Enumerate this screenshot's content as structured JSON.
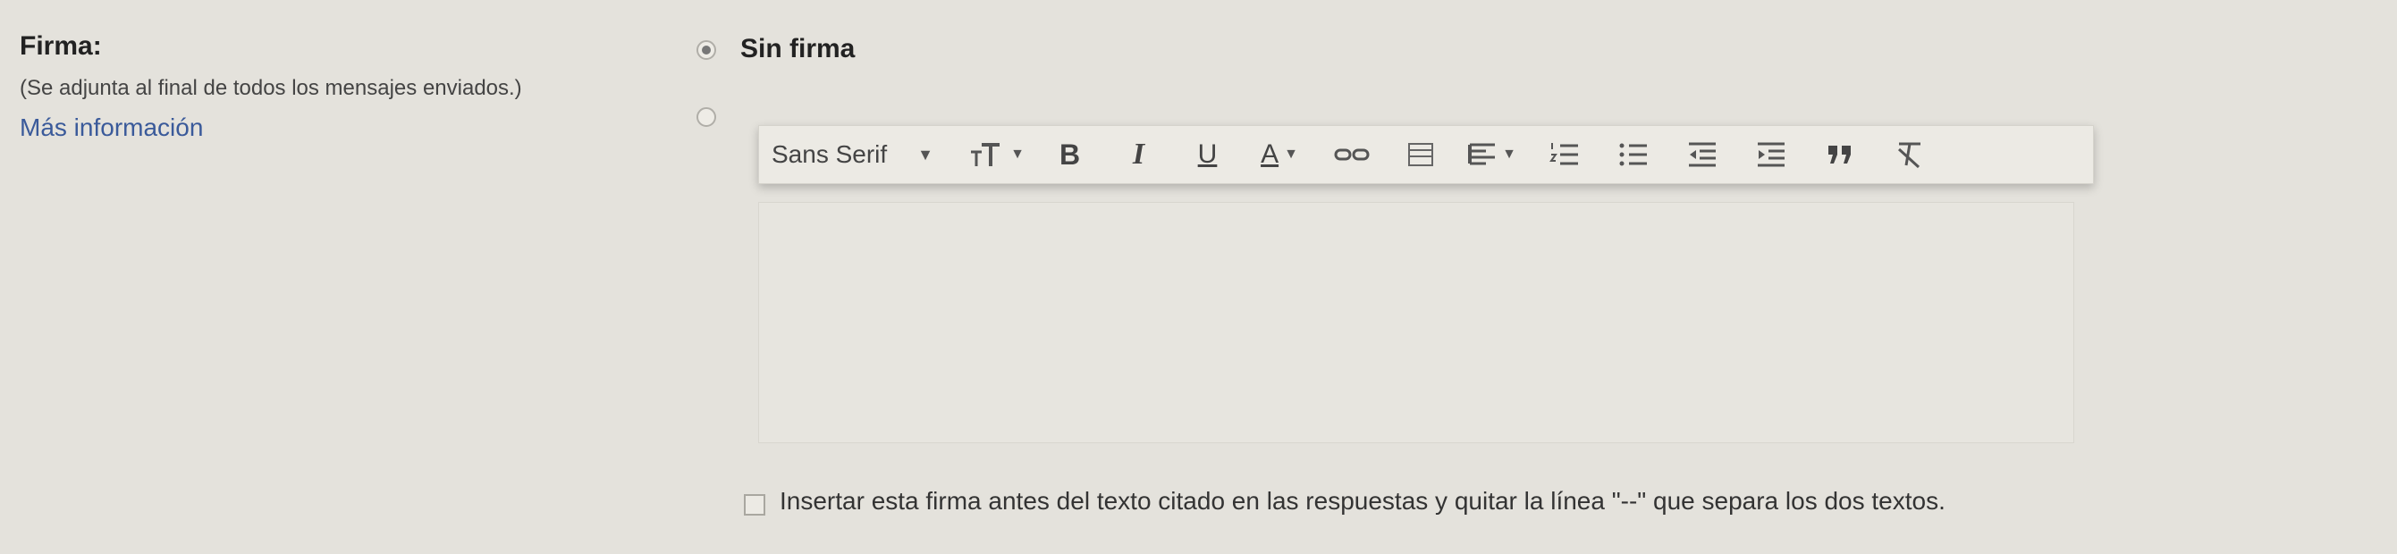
{
  "signature": {
    "title": "Firma:",
    "subtitle": "(Se adjunta al final de todos los mensajes enviados.)",
    "link": "Más información"
  },
  "options": {
    "none_label": "Sin firma",
    "selected": "none"
  },
  "toolbar": {
    "font_family": "Sans Serif",
    "buttons": [
      {
        "name": "text-size",
        "icon": "text-size-icon"
      },
      {
        "name": "bold",
        "label": "B"
      },
      {
        "name": "italic",
        "label": "I"
      },
      {
        "name": "underline",
        "label": "U"
      },
      {
        "name": "text-color",
        "label": "A"
      },
      {
        "name": "link",
        "icon": "link-icon"
      },
      {
        "name": "image",
        "icon": "image-icon"
      },
      {
        "name": "align",
        "icon": "align-left-icon"
      },
      {
        "name": "numbered-list",
        "icon": "numbered-list-icon"
      },
      {
        "name": "bulleted-list",
        "icon": "bulleted-list-icon"
      },
      {
        "name": "indent-less",
        "icon": "indent-less-icon"
      },
      {
        "name": "indent-more",
        "icon": "indent-more-icon"
      },
      {
        "name": "quote",
        "icon": "quote-icon"
      },
      {
        "name": "remove-formatting",
        "icon": "remove-formatting-icon"
      }
    ]
  },
  "editor": {
    "value": ""
  },
  "insert_before_quote": {
    "checked": false,
    "label": "Insertar esta firma antes del texto citado en las respuestas y quitar la línea \"--\" que separa los dos textos."
  }
}
